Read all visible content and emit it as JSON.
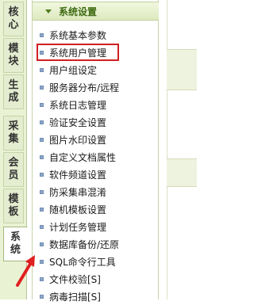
{
  "tabs": [
    {
      "label": "核心",
      "active": false
    },
    {
      "label": "模块",
      "active": false
    },
    {
      "label": "生成",
      "active": false
    },
    {
      "label": "采集",
      "active": false
    },
    {
      "label": "会员",
      "active": false
    },
    {
      "label": "模板",
      "active": false
    },
    {
      "label": "系统",
      "active": true
    }
  ],
  "panel": {
    "title": "系统设置",
    "items": [
      {
        "label": "系统基本参数"
      },
      {
        "label": "系统用户管理",
        "highlighted": true
      },
      {
        "label": "用户组设定"
      },
      {
        "label": "服务器分布/远程"
      },
      {
        "label": "系统日志管理"
      },
      {
        "label": "验证安全设置"
      },
      {
        "label": "图片水印设置"
      },
      {
        "label": "自定义文档属性"
      },
      {
        "label": "软件频道设置"
      },
      {
        "label": "防采集串混淆"
      },
      {
        "label": "随机模板设置"
      },
      {
        "label": "计划任务管理"
      },
      {
        "label": "数据库备份/还原"
      },
      {
        "label": "SQL命令行工具"
      },
      {
        "label": "文件校验[S]"
      },
      {
        "label": "病毒扫描[S]"
      }
    ]
  },
  "icons": {
    "collapse": "collapse-triangle-icon",
    "bullet": "square-bullet-icon",
    "annotation": "red-arrow-icon"
  },
  "colors": {
    "highlight_box": "#d02020",
    "header_text": "#3e6a12",
    "tab_bg": "#e4edcf",
    "bullet": "#8ea8c9"
  }
}
